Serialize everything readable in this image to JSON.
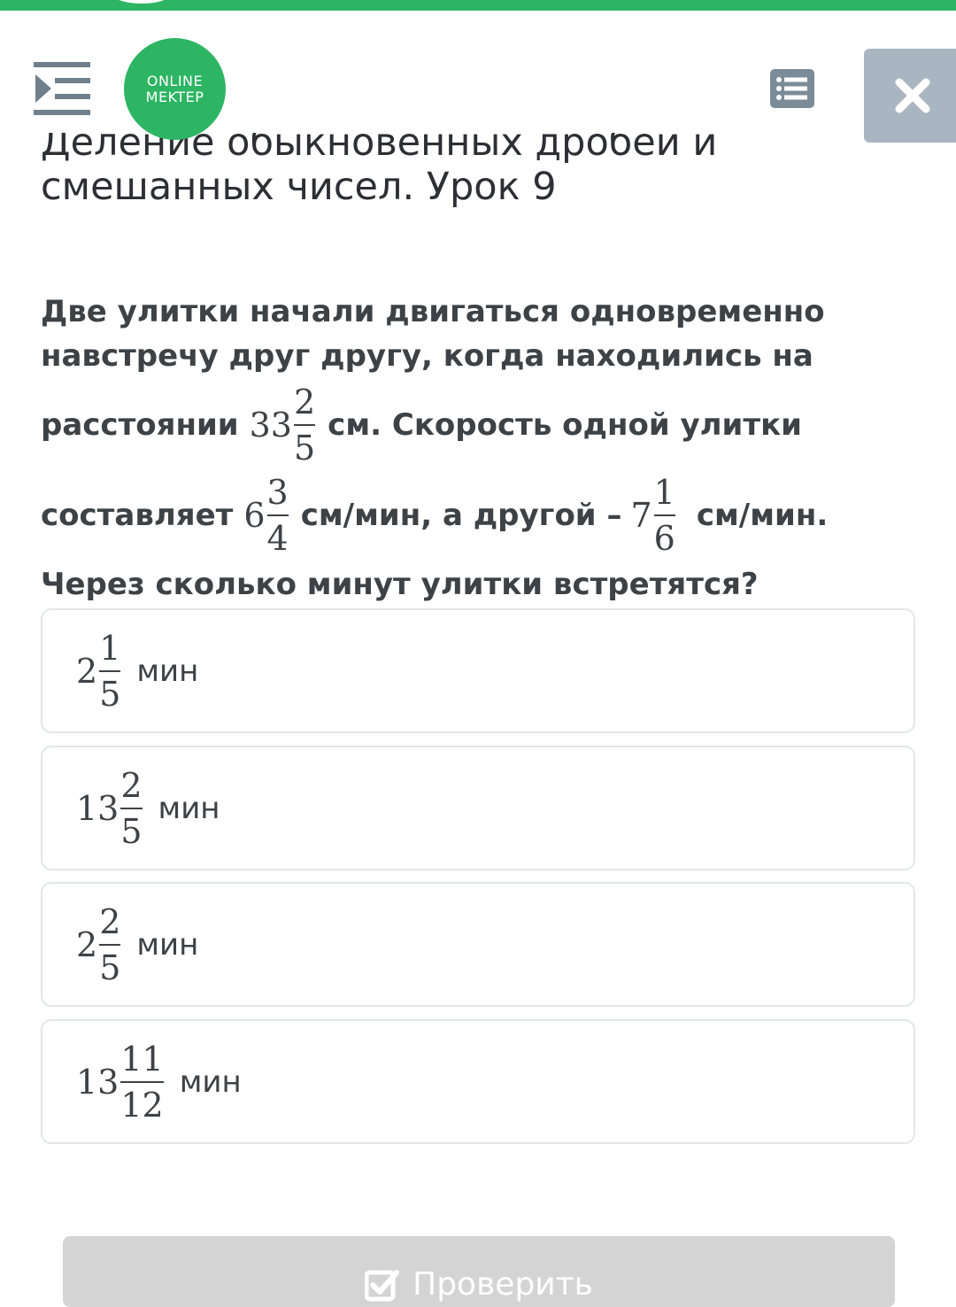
{
  "app": {
    "logo_line1": "ONLINE",
    "logo_line2": "MEKTEP",
    "accent": "#2db564"
  },
  "lesson": {
    "title_line1": "Деление обыкновенных дробей и",
    "title_line2": "смешанных чисел. Урок 9"
  },
  "question": {
    "line1": "Две улитки начали двигаться одновременно",
    "line2": "навстречу друг другу, когда находились на",
    "line3_a": "расстоянии",
    "distance": {
      "whole": "33",
      "num": "2",
      "den": "5"
    },
    "line3_b": "см. Скорость одной улитки",
    "line4_a": "составляет",
    "speed1": {
      "whole": "6",
      "num": "3",
      "den": "4"
    },
    "line4_b": "см/мин, а другой –",
    "speed2": {
      "whole": "7",
      "num": "1",
      "den": "6"
    },
    "line4_c": "см/мин.",
    "line5": "Через сколько минут улитки встретятся?"
  },
  "answers": [
    {
      "whole": "2",
      "num": "1",
      "den": "5",
      "unit": "мин"
    },
    {
      "whole": "13",
      "num": "2",
      "den": "5",
      "unit": "мин"
    },
    {
      "whole": "2",
      "num": "2",
      "den": "5",
      "unit": "мин"
    },
    {
      "whole": "13",
      "num": "11",
      "den": "12",
      "unit": "мин"
    }
  ],
  "check_button": {
    "label": "Проверить"
  },
  "icons": {
    "menu": "menu-collapse-icon",
    "list": "list-icon",
    "close": "close-icon",
    "check": "checkbox-icon"
  }
}
